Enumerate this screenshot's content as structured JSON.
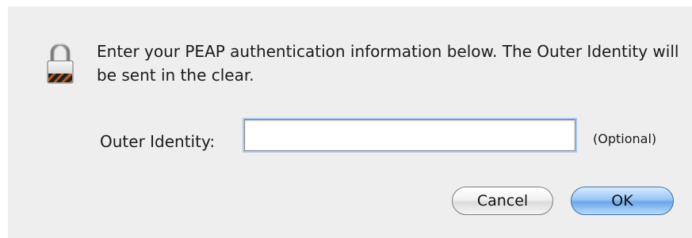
{
  "dialog": {
    "message": "Enter your PEAP authentication information below. The Outer Identity will be sent in the clear.",
    "icon": "lock-icon",
    "outer_identity": {
      "label": "Outer Identity:",
      "value": "",
      "note": "(Optional)"
    },
    "buttons": {
      "cancel_label": "Cancel",
      "ok_label": "OK"
    }
  },
  "colors": {
    "background": "#eeeeee",
    "default_button": "#6aa8ea",
    "focus_ring": "#a9c7ef"
  }
}
